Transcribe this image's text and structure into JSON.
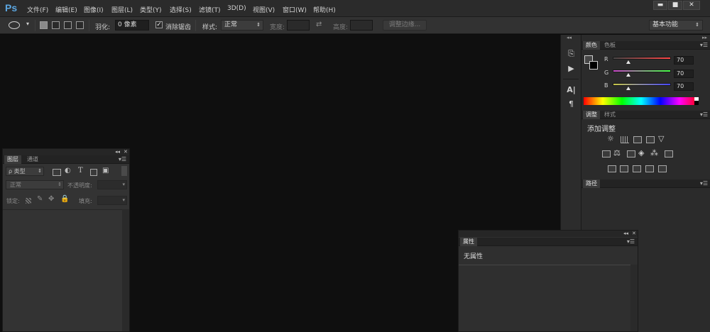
{
  "app": {
    "logo": "Ps"
  },
  "menu": {
    "items": [
      "文件(F)",
      "编辑(E)",
      "图像(I)",
      "图层(L)",
      "类型(Y)",
      "选择(S)",
      "滤镜(T)",
      "3D(D)",
      "视图(V)",
      "窗口(W)",
      "帮助(H)"
    ]
  },
  "window_controls": {
    "minimize": "▬",
    "restore": "■",
    "close": "✕"
  },
  "options": {
    "feather_label": "羽化:",
    "feather_value": "0 像素",
    "antialias_label": "消除锯齿",
    "antialias_checked": true,
    "style_label": "样式:",
    "style_value": "正常",
    "width_label": "宽度:",
    "height_label": "高度:",
    "refine_edge_button": "调整边缘...",
    "workspace_value": "基本功能"
  },
  "color_panel": {
    "tabs": [
      "颜色",
      "色板"
    ],
    "channels": [
      {
        "name": "R",
        "value": "70"
      },
      {
        "name": "G",
        "value": "70"
      },
      {
        "name": "B",
        "value": "70"
      }
    ]
  },
  "adjustments_panel": {
    "tabs": [
      "调整",
      "样式"
    ],
    "title": "添加调整"
  },
  "paths_panel": {
    "tabs": [
      "路径"
    ]
  },
  "layers_panel": {
    "tabs": [
      "图层",
      "通道"
    ],
    "filter_kind": "ρ 类型",
    "blend_mode": "正常",
    "opacity_label": "不透明度:",
    "lock_label": "锁定:",
    "fill_label": "填充:"
  },
  "properties_panel": {
    "tabs": [
      "属性"
    ],
    "empty_text": "无属性"
  },
  "colors": {
    "logo": "#5ba6e0",
    "canvas": "#0f0f0f",
    "panel": "#2b2b2b"
  }
}
